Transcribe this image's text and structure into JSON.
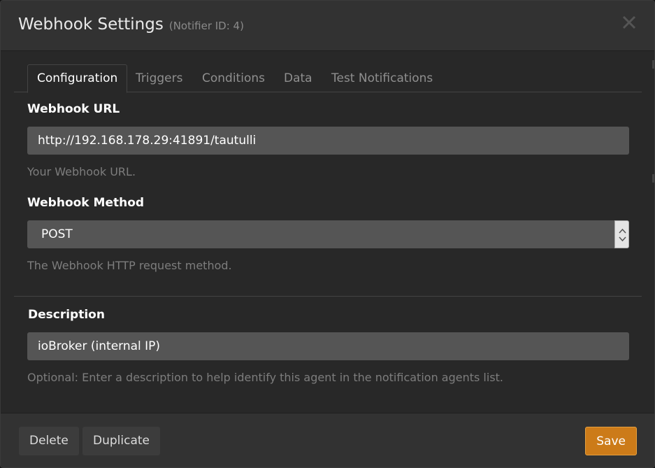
{
  "header": {
    "title": "Webhook Settings",
    "subtitle": "(Notifier ID: 4)"
  },
  "tabs": [
    {
      "label": "Configuration",
      "active": true
    },
    {
      "label": "Triggers",
      "active": false
    },
    {
      "label": "Conditions",
      "active": false
    },
    {
      "label": "Data",
      "active": false
    },
    {
      "label": "Test Notifications",
      "active": false
    }
  ],
  "form": {
    "url": {
      "label": "Webhook URL",
      "value": "http://192.168.178.29:41891/tautulli",
      "help": "Your Webhook URL."
    },
    "method": {
      "label": "Webhook Method",
      "value": "POST",
      "help": "The Webhook HTTP request method."
    },
    "description": {
      "label": "Description",
      "value": "ioBroker (internal IP)",
      "help": "Optional: Enter a description to help identify this agent in the notification agents list."
    }
  },
  "footer": {
    "delete_label": "Delete",
    "duplicate_label": "Duplicate",
    "save_label": "Save"
  },
  "colors": {
    "accent": "#cc7b19",
    "background": "#282828",
    "header": "#323232",
    "input": "#555555"
  }
}
